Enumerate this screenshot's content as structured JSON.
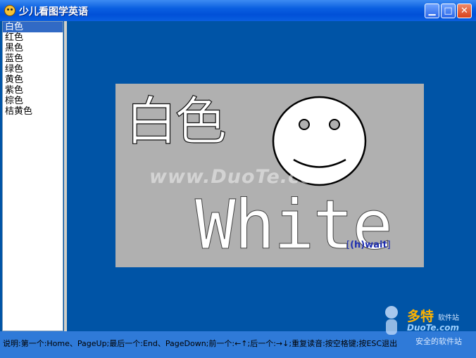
{
  "window": {
    "title": "少儿看图学英语",
    "icon": "smiley-app-icon"
  },
  "title_buttons": {
    "minimize": "▁",
    "maximize": "□",
    "close": "✕"
  },
  "sidebar": {
    "items": [
      "白色",
      "红色",
      "黑色",
      "蓝色",
      "绿色",
      "黄色",
      "紫色",
      "棕色",
      "桔黄色"
    ],
    "selected_index": 0
  },
  "card": {
    "chinese": "白色",
    "english": "White",
    "pron_open": "[",
    "pronunciation": "(h)wait",
    "pron_close": "]",
    "image": "smiley-face"
  },
  "watermark": "www.DuoTe.com",
  "statusbar": {
    "text": "说明:第一个:Home、PageUp;最后一个:End、PageDown;前一个:←↑;后一个:→↓;重复读音:按空格键;按ESC退出"
  },
  "logo": {
    "name": "多特",
    "sub": "软件站",
    "url": "DuoTe.com",
    "slogan": "安全的软件站"
  },
  "colors": {
    "background": "#0054a6",
    "card": "#b0b0b0",
    "selected": "#316ac5",
    "pronunciation": "#1f2fb0"
  }
}
